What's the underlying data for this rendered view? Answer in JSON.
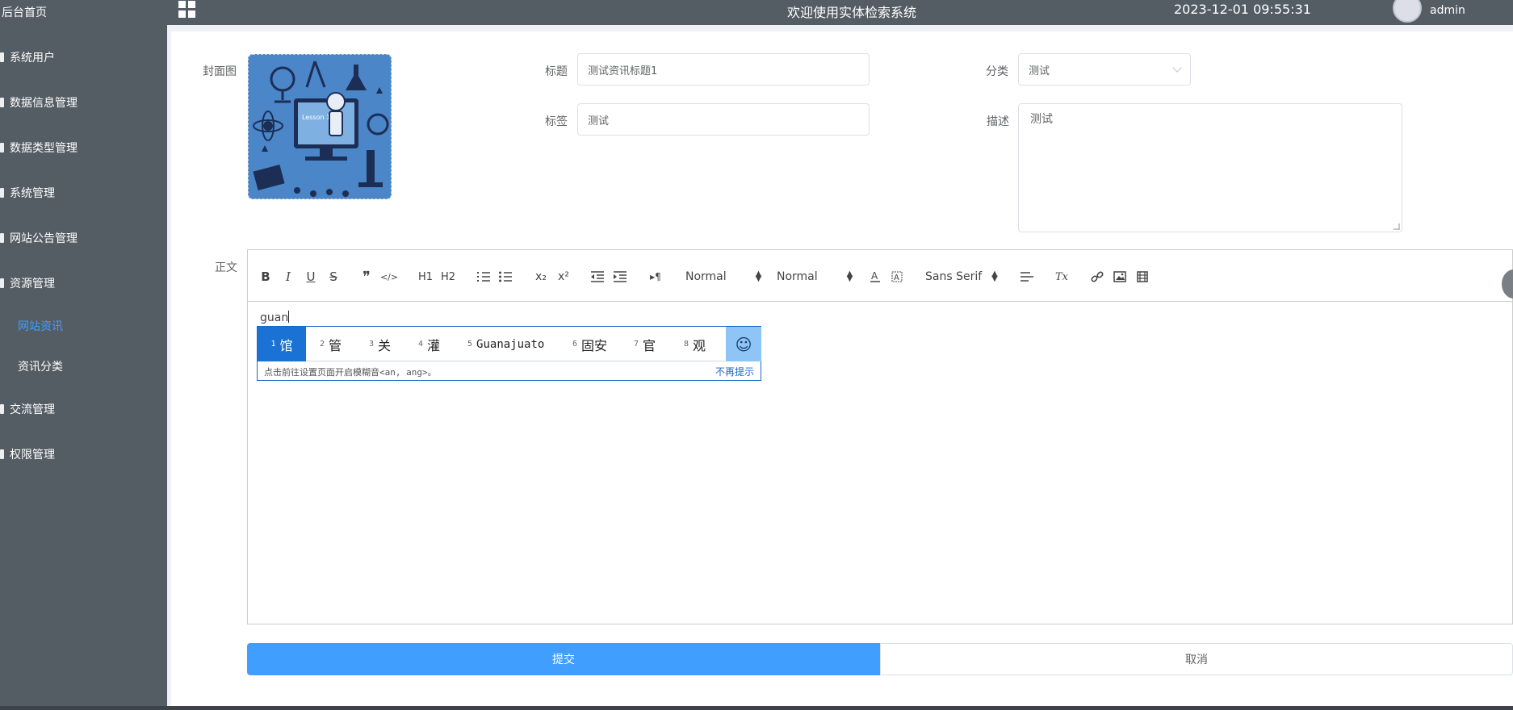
{
  "header": {
    "title": "欢迎使用实体检索系统",
    "datetime": "2023-12-01 09:55:31",
    "user": "admin"
  },
  "sidebar": {
    "items": [
      {
        "label": "后台首页"
      },
      {
        "label": "系统用户"
      },
      {
        "label": "数据信息管理"
      },
      {
        "label": "数据类型管理"
      },
      {
        "label": "系统管理"
      },
      {
        "label": "网站公告管理"
      },
      {
        "label": "资源管理"
      },
      {
        "label": "网站资讯",
        "active": true
      },
      {
        "label": "资讯分类"
      },
      {
        "label": "交流管理"
      },
      {
        "label": "权限管理"
      }
    ]
  },
  "form": {
    "cover_label": "封面图",
    "title_label": "标题",
    "title_value": "测试资讯标题1",
    "category_label": "分类",
    "category_value": "测试",
    "tag_label": "标签",
    "tag_value": "测试",
    "desc_label": "描述",
    "desc_value": "测试",
    "body_label": "正文"
  },
  "cover_image": {
    "caption": "Lesson 1"
  },
  "editor": {
    "toolbar": {
      "bold": "B",
      "italic": "I",
      "underline": "U",
      "strike": "S",
      "blockquote": "❞",
      "code": "</>",
      "h1": "H1",
      "h2": "H2",
      "sub": "x₂",
      "sup": "x²",
      "direction": "▸¶",
      "size_select": "Normal",
      "header_select": "Normal",
      "font_select": "Sans Serif",
      "clean": "Tx"
    },
    "content": "guan"
  },
  "ime": {
    "candidates": [
      {
        "num": "1",
        "text": "馆"
      },
      {
        "num": "2",
        "text": "管"
      },
      {
        "num": "3",
        "text": "关"
      },
      {
        "num": "4",
        "text": "灌"
      },
      {
        "num": "5",
        "text": "Guanajuato"
      },
      {
        "num": "6",
        "text": "固安"
      },
      {
        "num": "7",
        "text": "官"
      },
      {
        "num": "8",
        "text": "观"
      }
    ],
    "hint": "点击前往设置页面开启模糊音<an, ang>。",
    "dismiss": "不再提示"
  },
  "buttons": {
    "submit": "提交",
    "cancel": "取消"
  },
  "colors": {
    "sidebar_bg": "#545c64",
    "accent": "#409eff",
    "ime_highlight": "#1a73d4"
  }
}
